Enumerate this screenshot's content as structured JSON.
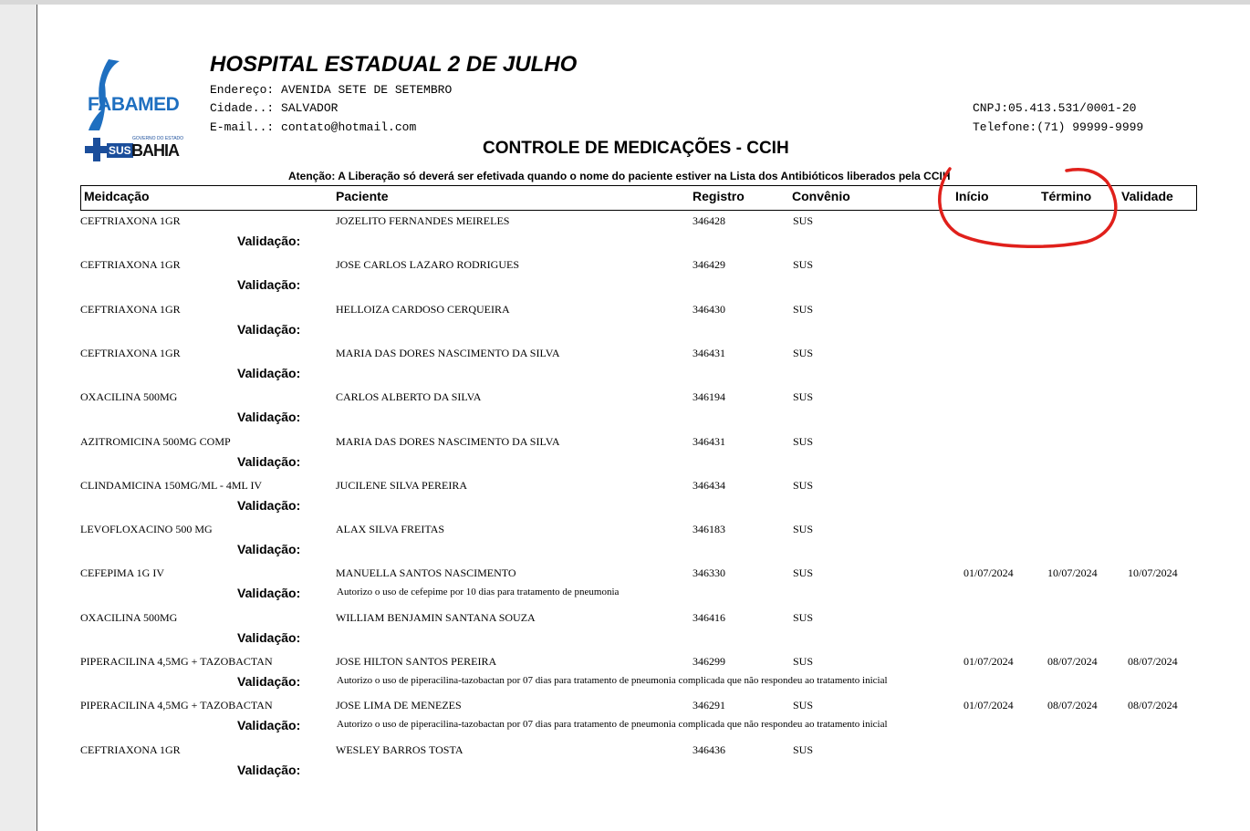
{
  "header": {
    "logo_fabamed": "FABAMED",
    "logo_sus": "SUS",
    "logo_gov": "GOVERNO DO ESTADO",
    "logo_bahia": "BAHIA",
    "hospital_name": "HOSPITAL ESTADUAL 2 DE JULHO",
    "address_label": "Endereço:",
    "address_value": "AVENIDA SETE DE SETEMBRO",
    "city_label": "Cidade..:",
    "city_value": "SALVADOR",
    "email_label": "E-mail..:",
    "email_value": "contato@hotmail.com",
    "cnpj_label": "CNPJ:",
    "cnpj_value": "05.413.531/0001-20",
    "phone_label": "Telefone:",
    "phone_value": "(71) 99999-9999",
    "title": "CONTROLE DE MEDICAÇÕES - CCIH",
    "notice": "Atenção: A Liberação só deverá ser efetivada quando o nome do paciente estiver na Lista dos Antibióticos liberados pela CCIH"
  },
  "columns": {
    "medicacao": "Meidcação",
    "paciente": "Paciente",
    "registro": "Registro",
    "convenio": "Convênio",
    "inicio": "Início",
    "termino": "Término",
    "validade": "Validade"
  },
  "validation_label": "Validação:",
  "rows": [
    {
      "medicacao": "CEFTRIAXONA 1GR",
      "paciente": "JOZELITO FERNANDES MEIRELES",
      "registro": "346428",
      "convenio": "SUS",
      "inicio": "",
      "termino": "",
      "validade": "",
      "validacao": ""
    },
    {
      "medicacao": "CEFTRIAXONA 1GR",
      "paciente": "JOSE CARLOS LAZARO RODRIGUES",
      "registro": "346429",
      "convenio": "SUS",
      "inicio": "",
      "termino": "",
      "validade": "",
      "validacao": ""
    },
    {
      "medicacao": "CEFTRIAXONA 1GR",
      "paciente": "HELLOIZA CARDOSO CERQUEIRA",
      "registro": "346430",
      "convenio": "SUS",
      "inicio": "",
      "termino": "",
      "validade": "",
      "validacao": ""
    },
    {
      "medicacao": "CEFTRIAXONA 1GR",
      "paciente": "MARIA DAS DORES NASCIMENTO DA SILVA",
      "registro": "346431",
      "convenio": "SUS",
      "inicio": "",
      "termino": "",
      "validade": "",
      "validacao": ""
    },
    {
      "medicacao": "OXACILINA 500MG",
      "paciente": "CARLOS ALBERTO DA SILVA",
      "registro": "346194",
      "convenio": "SUS",
      "inicio": "",
      "termino": "",
      "validade": "",
      "validacao": ""
    },
    {
      "medicacao": "AZITROMICINA 500MG COMP",
      "paciente": "MARIA DAS DORES NASCIMENTO DA SILVA",
      "registro": "346431",
      "convenio": "SUS",
      "inicio": "",
      "termino": "",
      "validade": "",
      "validacao": ""
    },
    {
      "medicacao": "CLINDAMICINA 150MG/ML - 4ML IV",
      "paciente": "JUCILENE SILVA PEREIRA",
      "registro": "346434",
      "convenio": "SUS",
      "inicio": "",
      "termino": "",
      "validade": "",
      "validacao": ""
    },
    {
      "medicacao": "LEVOFLOXACINO 500 MG",
      "paciente": "ALAX SILVA FREITAS",
      "registro": "346183",
      "convenio": "SUS",
      "inicio": "",
      "termino": "",
      "validade": "",
      "validacao": ""
    },
    {
      "medicacao": "CEFEPIMA 1G IV",
      "paciente": "MANUELLA SANTOS NASCIMENTO",
      "registro": "346330",
      "convenio": "SUS",
      "inicio": "01/07/2024",
      "termino": "10/07/2024",
      "validade": "10/07/2024",
      "validacao": "Autorizo o uso de cefepime por 10 dias para tratamento de pneumonia"
    },
    {
      "medicacao": "OXACILINA 500MG",
      "paciente": "WILLIAM BENJAMIN SANTANA SOUZA",
      "registro": "346416",
      "convenio": "SUS",
      "inicio": "",
      "termino": "",
      "validade": "",
      "validacao": ""
    },
    {
      "medicacao": "PIPERACILINA 4,5MG + TAZOBACTAN",
      "paciente": "JOSE HILTON SANTOS PEREIRA",
      "registro": "346299",
      "convenio": "SUS",
      "inicio": "01/07/2024",
      "termino": "08/07/2024",
      "validade": "08/07/2024",
      "validacao": "Autorizo o uso de piperacilina-tazobactan por 07 dias para tratamento de pneumonia complicada que não respondeu ao tratamento inicial"
    },
    {
      "medicacao": "PIPERACILINA 4,5MG + TAZOBACTAN",
      "paciente": "JOSE LIMA DE MENEZES",
      "registro": "346291",
      "convenio": "SUS",
      "inicio": "01/07/2024",
      "termino": "08/07/2024",
      "validade": "08/07/2024",
      "validacao": "Autorizo o uso de piperacilina-tazobactan por 07 dias para tratamento de pneumonia complicada que não respondeu ao tratamento inicial"
    },
    {
      "medicacao": "CEFTRIAXONA 1GR",
      "paciente": "WESLEY BARROS TOSTA",
      "registro": "346436",
      "convenio": "SUS",
      "inicio": "",
      "termino": "",
      "validade": "",
      "validacao": ""
    }
  ],
  "colors": {
    "annotation": "#e0201b",
    "fabamed_blue": "#1e6fc0",
    "sus_blue": "#1b4e9b"
  }
}
